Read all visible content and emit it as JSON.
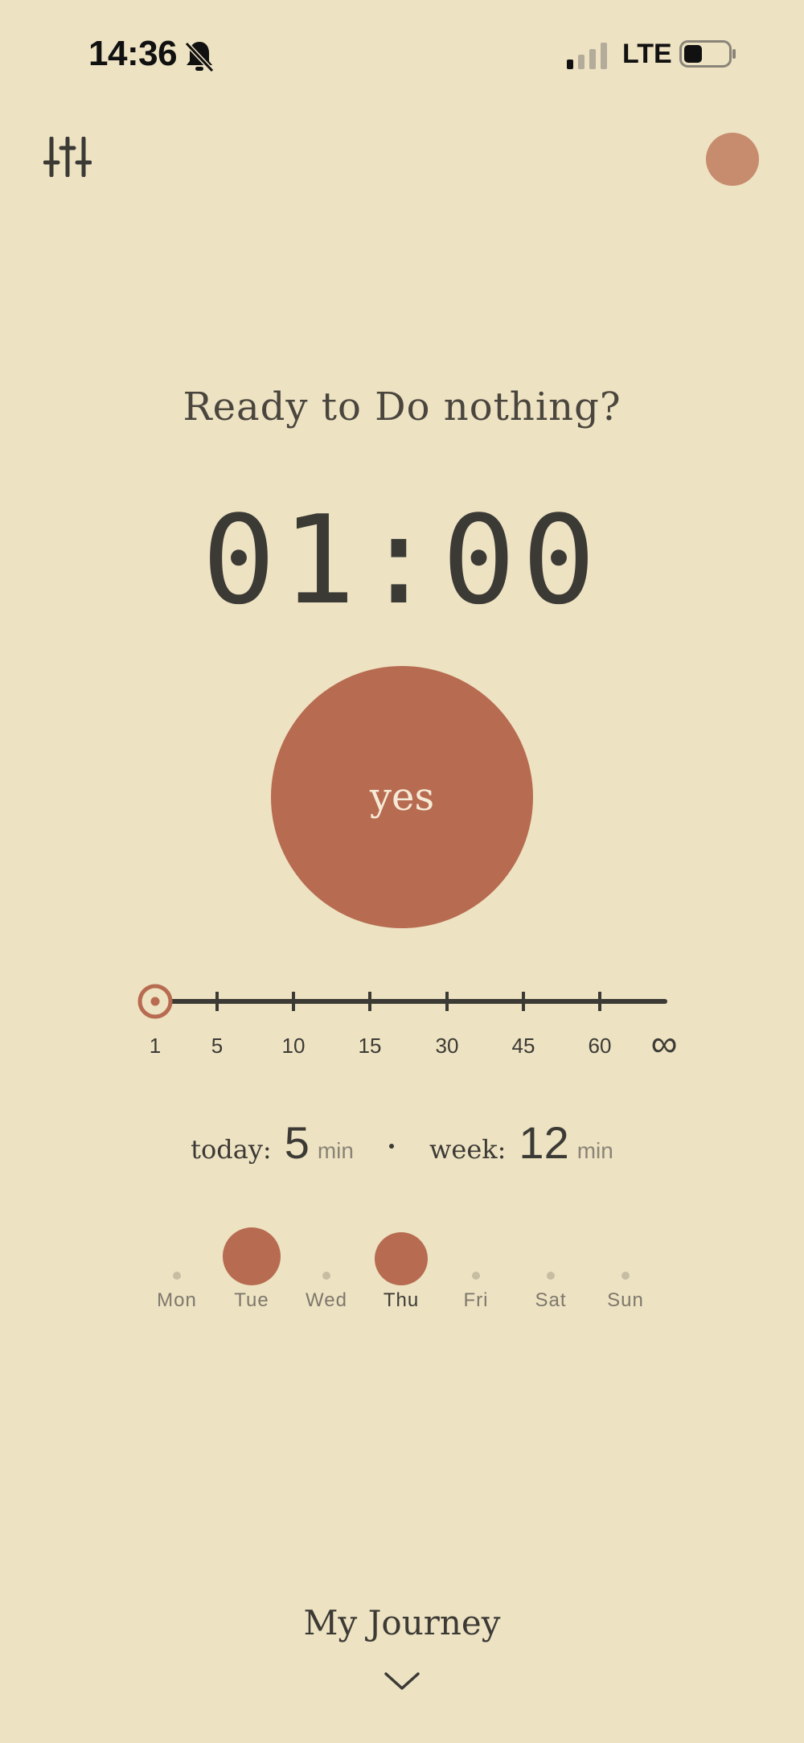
{
  "status_bar": {
    "time": "14:36",
    "network": "LTE",
    "icons": [
      "bell-slash-icon",
      "signal-icon",
      "battery-icon"
    ]
  },
  "header": {
    "settings_icon": "sliders-icon",
    "avatar_color": "#C78B6E"
  },
  "main": {
    "title": "Ready to Do nothing?",
    "timer": "01:00",
    "start_button_label": "yes"
  },
  "duration_slider": {
    "ticks": [
      "1",
      "5",
      "10",
      "15",
      "30",
      "45",
      "60",
      "∞"
    ],
    "selected": "1"
  },
  "stats": {
    "today_label": "today:",
    "today_value": "5",
    "today_unit": "min",
    "week_label": "week:",
    "week_value": "12",
    "week_unit": "min"
  },
  "week": {
    "days": [
      {
        "label": "Mon",
        "minutes": 0,
        "current": false
      },
      {
        "label": "Tue",
        "minutes": 5,
        "current": false
      },
      {
        "label": "Wed",
        "minutes": 0,
        "current": false
      },
      {
        "label": "Thu",
        "minutes": 4,
        "current": true
      },
      {
        "label": "Fri",
        "minutes": 0,
        "current": false
      },
      {
        "label": "Sat",
        "minutes": 0,
        "current": false
      },
      {
        "label": "Sun",
        "minutes": 0,
        "current": false
      }
    ]
  },
  "footer": {
    "journey_label": "My Journey",
    "expand_icon": "chevron-down-icon"
  },
  "colors": {
    "background": "#EDE2C2",
    "accent": "#B76B50",
    "text": "#3C3A35"
  }
}
